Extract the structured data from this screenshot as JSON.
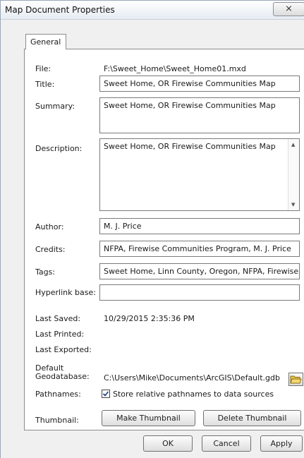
{
  "window": {
    "title": "Map Document Properties",
    "close_glyph": "⨯"
  },
  "tabs": [
    {
      "label": "General"
    }
  ],
  "fields": {
    "file": {
      "label": "File:",
      "value": "F:\\Sweet_Home\\Sweet_Home01.mxd"
    },
    "title": {
      "label": "Title:",
      "value": "Sweet Home, OR Firewise Communities Map"
    },
    "summary": {
      "label": "Summary:",
      "value": "Sweet Home, OR Firewise Communities Map"
    },
    "description": {
      "label": "Description:",
      "value": "Sweet Home, OR Firewise Communities Map"
    },
    "author": {
      "label": "Author:",
      "value": "M. J. Price"
    },
    "credits": {
      "label": "Credits:",
      "value": "NFPA, Firewise Communities Program, M. J. Price"
    },
    "tags": {
      "label": "Tags:",
      "value": "Sweet Home, Linn County, Oregon, NFPA, Firewise"
    },
    "hyperlink_base": {
      "label": "Hyperlink base:",
      "value": ""
    },
    "last_saved": {
      "label": "Last Saved:",
      "value": "10/29/2015 2:35:36 PM"
    },
    "last_printed": {
      "label": "Last Printed:",
      "value": ""
    },
    "last_exported": {
      "label": "Last Exported:",
      "value": ""
    },
    "default_geodatabase": {
      "label_line1": "Default",
      "label_line2": "Geodatabase:",
      "value": "C:\\Users\\Mike\\Documents\\ArcGIS\\Default.gdb"
    },
    "pathnames": {
      "label": "Pathnames:",
      "checkbox_label": "Store relative pathnames to data sources",
      "checked": true
    },
    "thumbnail": {
      "label": "Thumbnail:"
    }
  },
  "buttons": {
    "make_thumbnail": "Make Thumbnail",
    "delete_thumbnail": "Delete Thumbnail",
    "ok": "OK",
    "cancel": "Cancel",
    "apply": "Apply"
  },
  "icons": {
    "folder": "folder-open-icon",
    "close": "close-icon"
  }
}
